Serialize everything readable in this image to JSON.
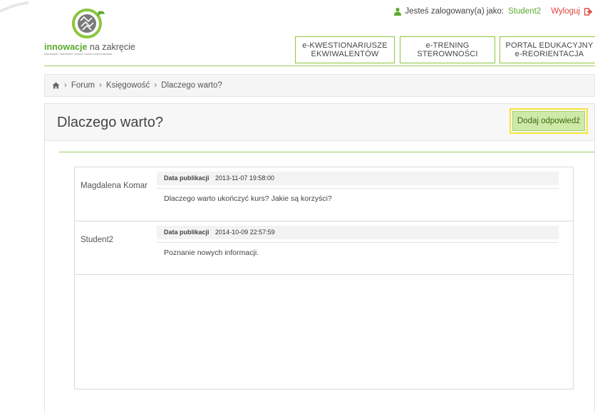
{
  "header": {
    "logo": {
      "brand_bold": "innowacje",
      "brand_rest": " na zakręcie",
      "tagline": "testowanie i wdrażanie nowych metod rozpoznawania"
    },
    "login": {
      "prefix": "Jesteś zalogowany(a) jako:",
      "username": "Student2",
      "logout_label": "Wyloguj"
    },
    "nav": [
      {
        "line1": "e-KWESTIONARIUSZE",
        "line2": "EKWIWALENTÓW"
      },
      {
        "line1": "e-TRENING",
        "line2": "STEROWNOŚCI"
      },
      {
        "line1": "PORTAL EDUKACYJNY",
        "line2": "e-REORIENTACJA"
      }
    ]
  },
  "breadcrumb": {
    "items": [
      "Forum",
      "Księgowość",
      "Dlaczego warto?"
    ],
    "separator": "›"
  },
  "topic": {
    "title": "Dlaczego warto?",
    "add_reply_label": "Dodaj odpowiedź"
  },
  "posts": [
    {
      "author": "Magdalena Komar",
      "date_label": "Data publikacji",
      "date": "2013-11-07 19:58:00",
      "content": "Dlaczego warto ukończyć kurs? Jakie są korzyści?"
    },
    {
      "author": "Student2",
      "date_label": "Data publikacji",
      "date": "2014-10-09 22:57:59",
      "content": "Poznanie nowych informacji."
    }
  ],
  "colors": {
    "accent_green": "#5aaa2c",
    "button_bg": "#cfe9a8",
    "highlight_border": "#f5e53a",
    "logout_red": "#e0453a"
  }
}
